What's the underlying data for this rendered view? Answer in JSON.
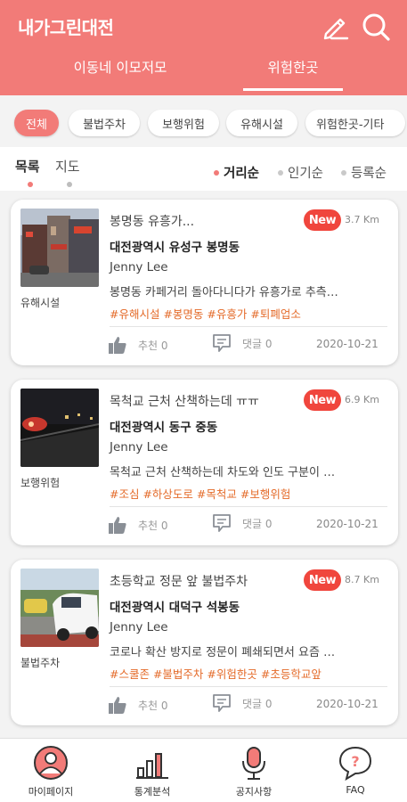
{
  "app": {
    "title": "내가그린대전",
    "icons": [
      "pencil-icon",
      "search-icon"
    ],
    "accent_color": "#f27b78"
  },
  "header_tabs": [
    {
      "label": "이동네 이모저모",
      "active": false
    },
    {
      "label": "위험한곳",
      "active": true
    }
  ],
  "chips": [
    {
      "label": "전체",
      "active": true
    },
    {
      "label": "불법주차",
      "active": false
    },
    {
      "label": "보행위험",
      "active": false
    },
    {
      "label": "유해시설",
      "active": false
    },
    {
      "label": "위험한곳-기타",
      "active": false
    }
  ],
  "view_tabs": [
    {
      "label": "목록",
      "active": true
    },
    {
      "label": "지도",
      "active": false
    }
  ],
  "sort_options": [
    {
      "label": "거리순",
      "active": true
    },
    {
      "label": "인기순",
      "active": false
    },
    {
      "label": "등록순",
      "active": false
    }
  ],
  "posts": [
    {
      "category": "유해시설",
      "title": "봉명동 유흥가...",
      "badge": "New",
      "distance": "3.7 Km",
      "address": "대전광역시 유성구 봉명동",
      "author": "Jenny Lee",
      "excerpt": "봉명동 카페거리 돌아다니다가 유흥가로 추측…",
      "tags": "#유해시설 #봉명동 #유흥가 #퇴폐업소",
      "likes": "추천 0",
      "comments": "댓글 0",
      "date": "2020-10-21",
      "thumb_icon": "street-buildings-photo"
    },
    {
      "category": "보행위험",
      "title": "목척교 근처 산책하는데 ㅠㅠ",
      "badge": "New",
      "distance": "6.9 Km",
      "address": "대전광역시 동구 중동",
      "author": "Jenny Lee",
      "excerpt": "목척교 근처 산책하는데 차도와 인도 구분이 …",
      "tags": "#조심 #하상도로 #목척교 #보행위험",
      "likes": "추천 0",
      "comments": "댓글 0",
      "date": "2020-10-21",
      "thumb_icon": "night-road-photo"
    },
    {
      "category": "불법주차",
      "title": "초등학교 정문 앞 불법주차",
      "badge": "New",
      "distance": "8.7 Km",
      "address": "대전광역시 대덕구 석봉동",
      "author": "Jenny Lee",
      "excerpt": "코로나 확산 방지로 정문이 폐쇄되면서 요즘 …",
      "tags": "#스쿨존 #불법주차 #위험한곳 #초등학교앞",
      "likes": "추천 0",
      "comments": "댓글 0",
      "date": "2020-10-21",
      "thumb_icon": "parked-car-photo"
    }
  ],
  "bottom_nav": [
    {
      "label": "마이페이지",
      "icon": "user-icon"
    },
    {
      "label": "통계분석",
      "icon": "bar-chart-icon"
    },
    {
      "label": "공지사항",
      "icon": "microphone-icon"
    },
    {
      "label": "FAQ",
      "icon": "faq-bubble-icon"
    }
  ]
}
